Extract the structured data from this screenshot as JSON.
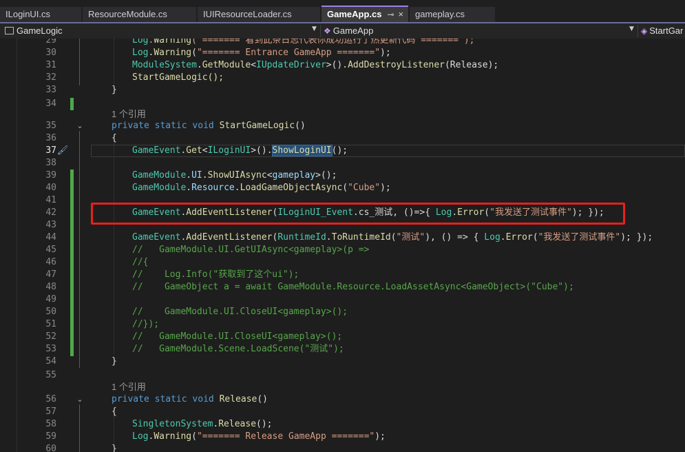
{
  "tabs": [
    {
      "label": "ILoginUI.cs",
      "active": false
    },
    {
      "label": "ResourceModule.cs",
      "active": false
    },
    {
      "label": "IUIResourceLoader.cs",
      "active": false
    },
    {
      "label": "GameApp.cs",
      "active": true
    },
    {
      "label": "gameplay.cs",
      "active": false
    }
  ],
  "tab_pin_icon": "pin-icon",
  "tab_close_glyph": "×",
  "nav": {
    "project": "GameLogic",
    "class": "GameApp",
    "member": "StartGar"
  },
  "colors": {
    "keyword": "#569cd6",
    "type": "#4ec9b0",
    "method": "#dcdcaa",
    "string": "#d69d85",
    "comment": "#57a64a",
    "highlight_box": "#e8201c",
    "change_bar": "#4fa84a",
    "active_tab_accent": "#a080e6"
  },
  "codelens": {
    "refs_34": "1 个引用",
    "refs_55": "1 个引用"
  },
  "lines": {
    "l29": {
      "num": "29",
      "text": "Log.Warning(\"======= 看到此条日志代表你成功运行了热更新代码 =======\");"
    },
    "l30": {
      "num": "30",
      "text": "Log.Warning(\"======= Entrance GameApp =======\");"
    },
    "l31": {
      "num": "31",
      "text": "ModuleSystem.GetModule<IUpdateDriver>().AddDestroyListener(Release);"
    },
    "l32": {
      "num": "32",
      "text": "StartGameLogic();"
    },
    "l33": {
      "num": "33",
      "text": "}"
    },
    "l34": {
      "num": "34",
      "text": ""
    },
    "l35": {
      "num": "35",
      "text": "private static void StartGameLogic()"
    },
    "l36": {
      "num": "36",
      "text": "{"
    },
    "l37": {
      "num": "37",
      "text": "GameEvent.Get<ILoginUI>().ShowLoginUI();"
    },
    "l38": {
      "num": "38",
      "text": ""
    },
    "l39": {
      "num": "39",
      "text": "GameModule.UI.ShowUIAsync<gameplay>();"
    },
    "l40": {
      "num": "40",
      "text": "GameModule.Resource.LoadGameObjectAsync(\"Cube\");"
    },
    "l41": {
      "num": "41",
      "text": ""
    },
    "l42": {
      "num": "42",
      "text": "GameEvent.AddEventListener(ILoginUI_Event.cs_测试, ()=>{ Log.Error(\"我发送了测试事件\"); });"
    },
    "l43": {
      "num": "43",
      "text": ""
    },
    "l44": {
      "num": "44",
      "text": "GameEvent.AddEventListener(RuntimeId.ToRuntimeId(\"测试\"), () => { Log.Error(\"我发送了测试事件\"); });"
    },
    "l45": {
      "num": "45",
      "text": "//   GameModule.UI.GetUIAsync<gameplay>(p =>"
    },
    "l46": {
      "num": "46",
      "text": "//{"
    },
    "l47": {
      "num": "47",
      "text": "//    Log.Info(\"获取到了这个ui\");"
    },
    "l48": {
      "num": "48",
      "text": "//    GameObject a = await GameModule.Resource.LoadAssetAsync<GameObject>(\"Cube\");"
    },
    "l49": {
      "num": "49",
      "text": ""
    },
    "l50": {
      "num": "50",
      "text": "//    GameModule.UI.CloseUI<gameplay>();"
    },
    "l51": {
      "num": "51",
      "text": "//});"
    },
    "l52": {
      "num": "52",
      "text": "//   GameModule.UI.CloseUI<gameplay>();"
    },
    "l53": {
      "num": "53",
      "text": "//   GameModule.Scene.LoadScene(\"测试\");"
    },
    "l54": {
      "num": "54",
      "text": "}"
    },
    "l55": {
      "num": "55",
      "text": ""
    },
    "l56": {
      "num": "56",
      "text": "private static void Release()"
    },
    "l57": {
      "num": "57",
      "text": "{"
    },
    "l58": {
      "num": "58",
      "text": "SingletonSystem.Release();"
    },
    "l59": {
      "num": "59",
      "text": "Log.Warning(\"======= Release GameApp =======\");"
    },
    "l60": {
      "num": "60",
      "text": "}"
    }
  },
  "tokens": {
    "kw_private": "private",
    "kw_static": "static",
    "kw_void": "void"
  }
}
